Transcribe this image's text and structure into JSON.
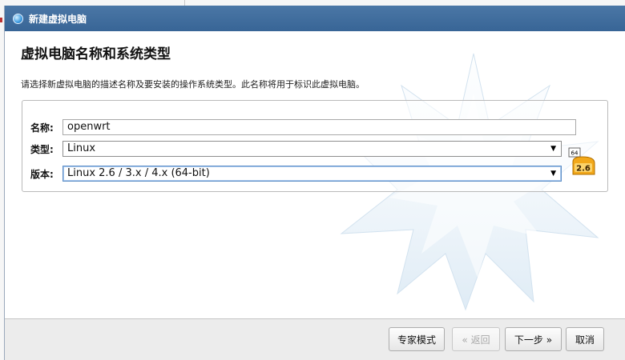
{
  "dialog": {
    "title": "新建虚拟电脑",
    "heading": "虚拟电脑名称和系统类型",
    "description": "请选择新虚拟电脑的描述名称及要安装的操作系统类型。此名称将用于标识此虚拟电脑。"
  },
  "form": {
    "name_label": "名称:",
    "name_value": "openwrt",
    "type_label": "类型:",
    "type_value": "Linux",
    "version_label": "版本:",
    "version_value": "Linux 2.6 / 3.x / 4.x (64-bit)"
  },
  "os_icon": {
    "name": "linux-2.6-64bit-icon",
    "badge_top": "64",
    "badge_main": "2.6"
  },
  "footer": {
    "expert_label": "专家模式",
    "back_label": "« 返回",
    "next_label": "下一步 »",
    "cancel_label": "取消"
  },
  "colors": {
    "titlebar": "#3f6c9c",
    "accent": "#5e8fc7",
    "footer_bg": "#ececec"
  }
}
